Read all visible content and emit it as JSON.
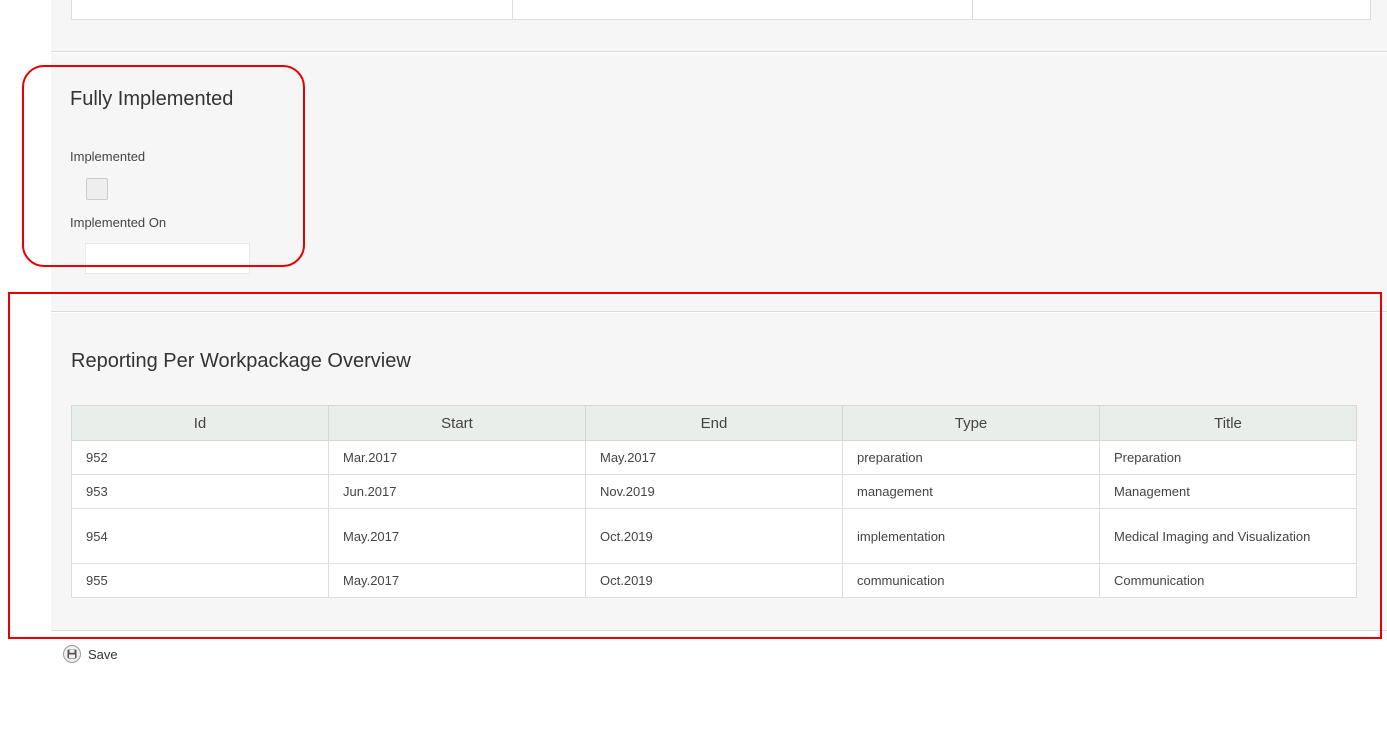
{
  "fully_implemented": {
    "title": "Fully Implemented",
    "implemented_label": "Implemented",
    "implemented_checked": false,
    "implemented_on_label": "Implemented On",
    "implemented_on_value": ""
  },
  "workpackages": {
    "title": "Reporting Per Workpackage Overview",
    "columns": [
      "Id",
      "Start",
      "End",
      "Type",
      "Title"
    ],
    "rows": [
      [
        "952",
        "Mar.2017",
        "May.2017",
        "preparation",
        "Preparation"
      ],
      [
        "953",
        "Jun.2017",
        "Nov.2019",
        "management",
        "Management"
      ],
      [
        "954",
        "May.2017",
        "Oct.2019",
        "implementation",
        "Medical Imaging and Visualization"
      ],
      [
        "955",
        "May.2017",
        "Oct.2019",
        "communication",
        "Communication"
      ]
    ]
  },
  "actions": {
    "save_label": "Save",
    "save_icon": "floppy-disk-icon"
  },
  "colors": {
    "annotation": "#e60000",
    "panel_bg": "#f6f6f6",
    "table_header_bg": "#eaeeea"
  }
}
